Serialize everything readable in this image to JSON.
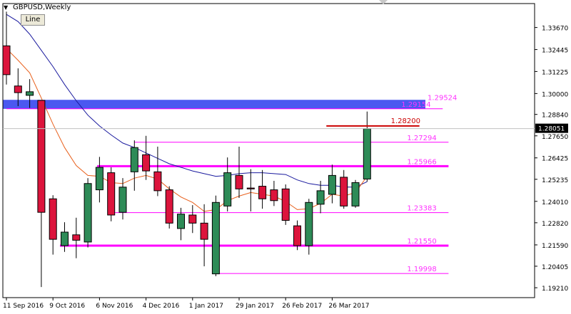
{
  "window": {
    "symbol_title": "GBPUSD,Weekly",
    "chart_mode_button": "Line"
  },
  "colors": {
    "bull": "#2e8b57",
    "bear": "#dc143c",
    "level_line": "#ff00ff",
    "level_text": "#ff33ff",
    "zone_fill": "#4b58f0",
    "resistance": "#cc0000",
    "ma_slow": "#1a1a9e",
    "ma_fast": "#e8601c",
    "grid_axis": "#000000"
  },
  "chart_data": {
    "type": "candlestick",
    "ylim": [
      1.1866,
      1.35
    ],
    "y_ticks": [
      "1.33670",
      "1.32445",
      "1.31225",
      "1.30000",
      "1.28840",
      "1.27650",
      "1.26425",
      "1.25235",
      "1.24010",
      "1.22820",
      "1.21590",
      "1.20405",
      "1.19210"
    ],
    "current_price": "1.28051",
    "x_labels": [
      {
        "label": "11 Sep 2016",
        "index": 0
      },
      {
        "label": "9 Oct 2016",
        "index": 4
      },
      {
        "label": "6 Nov 2016",
        "index": 8
      },
      {
        "label": "4 Dec 2016",
        "index": 12
      },
      {
        "label": "1 Jan 2017",
        "index": 16
      },
      {
        "label": "29 Jan 2017",
        "index": 20
      },
      {
        "label": "26 Feb 2017",
        "index": 24
      },
      {
        "label": "26 Mar 2017",
        "index": 28
      }
    ],
    "candles": [
      {
        "o": 1.3265,
        "h": 1.3455,
        "l": 1.305,
        "c": 1.3105
      },
      {
        "o": 1.3042,
        "h": 1.314,
        "l": 1.293,
        "c": 1.3005
      },
      {
        "o": 1.299,
        "h": 1.308,
        "l": 1.292,
        "c": 1.301
      },
      {
        "o": 1.2962,
        "h": 1.2962,
        "l": 1.1925,
        "c": 1.234
      },
      {
        "o": 1.2415,
        "h": 1.2435,
        "l": 1.2105,
        "c": 1.219
      },
      {
        "o": 1.2155,
        "h": 1.2285,
        "l": 1.212,
        "c": 1.223
      },
      {
        "o": 1.2215,
        "h": 1.231,
        "l": 1.2085,
        "c": 1.2185
      },
      {
        "o": 1.2175,
        "h": 1.253,
        "l": 1.2145,
        "c": 1.25
      },
      {
        "o": 1.2465,
        "h": 1.2648,
        "l": 1.2395,
        "c": 1.259
      },
      {
        "o": 1.256,
        "h": 1.259,
        "l": 1.229,
        "c": 1.2325
      },
      {
        "o": 1.234,
        "h": 1.253,
        "l": 1.23,
        "c": 1.248
      },
      {
        "o": 1.2565,
        "h": 1.274,
        "l": 1.246,
        "c": 1.27
      },
      {
        "o": 1.266,
        "h": 1.2765,
        "l": 1.252,
        "c": 1.257
      },
      {
        "o": 1.2565,
        "h": 1.2705,
        "l": 1.243,
        "c": 1.246
      },
      {
        "o": 1.2465,
        "h": 1.2485,
        "l": 1.225,
        "c": 1.228
      },
      {
        "o": 1.225,
        "h": 1.2365,
        "l": 1.2185,
        "c": 1.233
      },
      {
        "o": 1.2325,
        "h": 1.238,
        "l": 1.2225,
        "c": 1.228
      },
      {
        "o": 1.228,
        "h": 1.2385,
        "l": 1.204,
        "c": 1.219
      },
      {
        "o": 1.1998,
        "h": 1.2433,
        "l": 1.1985,
        "c": 1.2395
      },
      {
        "o": 1.2375,
        "h": 1.2645,
        "l": 1.2345,
        "c": 1.256
      },
      {
        "o": 1.2545,
        "h": 1.2705,
        "l": 1.242,
        "c": 1.247
      },
      {
        "o": 1.2475,
        "h": 1.258,
        "l": 1.2345,
        "c": 1.247
      },
      {
        "o": 1.2485,
        "h": 1.2575,
        "l": 1.236,
        "c": 1.2415
      },
      {
        "o": 1.2465,
        "h": 1.2515,
        "l": 1.2375,
        "c": 1.2405
      },
      {
        "o": 1.247,
        "h": 1.2495,
        "l": 1.227,
        "c": 1.2295
      },
      {
        "o": 1.2265,
        "h": 1.2295,
        "l": 1.213,
        "c": 1.2155
      },
      {
        "o": 1.2155,
        "h": 1.2415,
        "l": 1.2105,
        "c": 1.2395
      },
      {
        "o": 1.2385,
        "h": 1.2515,
        "l": 1.2335,
        "c": 1.246
      },
      {
        "o": 1.244,
        "h": 1.2605,
        "l": 1.239,
        "c": 1.2545
      },
      {
        "o": 1.2535,
        "h": 1.2575,
        "l": 1.236,
        "c": 1.2375
      },
      {
        "o": 1.2375,
        "h": 1.252,
        "l": 1.2365,
        "c": 1.2505
      },
      {
        "o": 1.2525,
        "h": 1.29,
        "l": 1.251,
        "c": 1.2805
      }
    ],
    "ma_slow": [
      1.344,
      1.34,
      1.333,
      1.324,
      1.315,
      1.305,
      1.296,
      1.288,
      1.282,
      1.277,
      1.2725,
      1.27,
      1.267,
      1.264,
      1.261,
      1.259,
      1.257,
      1.2555,
      1.254,
      1.2545,
      1.2555,
      1.256,
      1.256,
      1.2555,
      1.255,
      1.252,
      1.25,
      1.249,
      1.249,
      1.248,
      1.248,
      1.251
    ],
    "ma_fast": [
      1.325,
      1.3185,
      1.3115,
      1.2975,
      1.283,
      1.27,
      1.26,
      1.2545,
      1.254,
      1.2505,
      1.25,
      1.253,
      1.2545,
      1.2525,
      1.247,
      1.2425,
      1.2395,
      1.2345,
      1.2355,
      1.2405,
      1.243,
      1.245,
      1.244,
      1.243,
      1.24,
      1.2355,
      1.236,
      1.239,
      1.244,
      1.243,
      1.245,
      1.254
    ],
    "zone": {
      "top": 1.2965,
      "bottom": 1.2915
    },
    "levels": [
      {
        "label": "1.29524",
        "price": 1.29524,
        "x_start": 33.5,
        "x_end": 33.5,
        "thick": false,
        "kind": "label_only"
      },
      {
        "label": "1.29154",
        "price": 1.29154,
        "x_start": 0,
        "x_end": 37.5,
        "thick": false,
        "kind": "thin"
      },
      {
        "label": "1.27294",
        "price": 1.27294,
        "x_start": 11,
        "x_end": 38,
        "thick": false,
        "kind": "thin"
      },
      {
        "label": "1.25966",
        "price": 1.25966,
        "x_start": 7.8,
        "x_end": 38,
        "thick": true,
        "kind": "thick"
      },
      {
        "label": "1.23383",
        "price": 1.23383,
        "x_start": 9,
        "x_end": 38,
        "thick": false,
        "kind": "thin"
      },
      {
        "label": "1.21550",
        "price": 1.2155,
        "x_start": 4.6,
        "x_end": 38,
        "thick": true,
        "kind": "thick"
      },
      {
        "label": "1.19998",
        "price": 1.19998,
        "x_start": 18.3,
        "x_end": 38,
        "thick": false,
        "kind": "thin"
      }
    ],
    "resistance": {
      "label": "1.28200",
      "price": 1.282,
      "x_start": 27.5,
      "x_end": 35.5
    }
  }
}
